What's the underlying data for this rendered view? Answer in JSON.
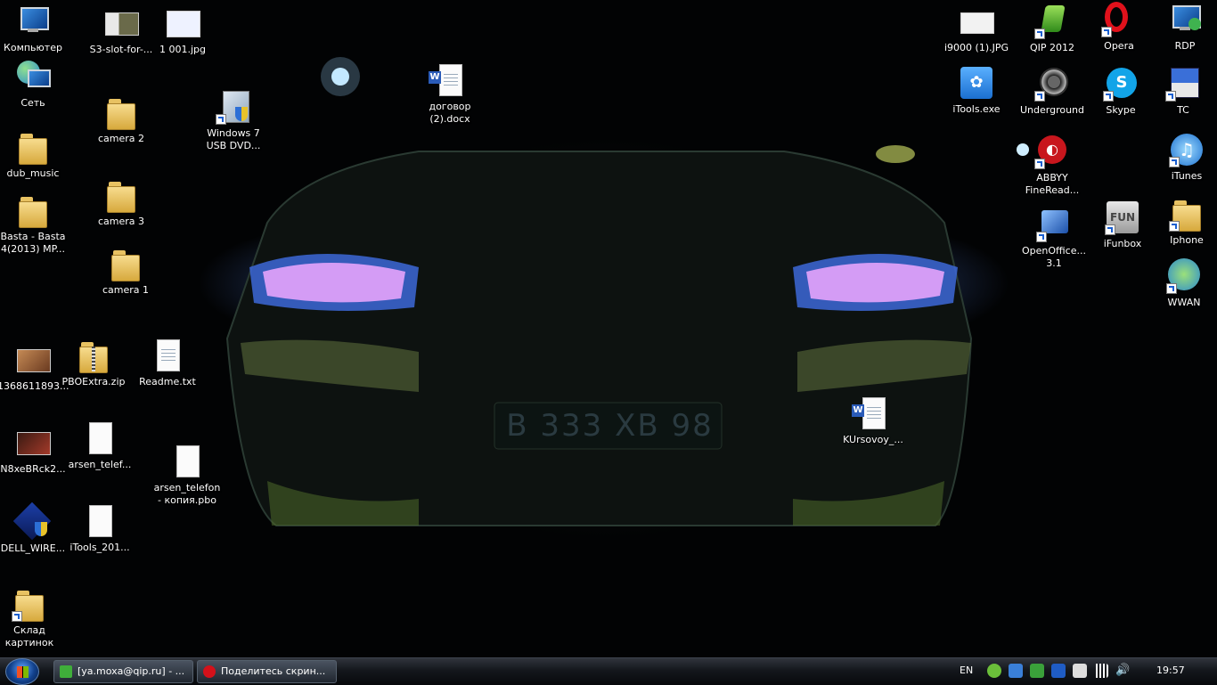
{
  "desktop": {
    "icons": [
      {
        "label": "Компьютер",
        "name": "computer-icon"
      },
      {
        "label": "Сеть",
        "name": "network-icon"
      },
      {
        "label": "dub_music",
        "name": "folder-icon"
      },
      {
        "label": "Basta - Basta\n4(2013) MP...",
        "name": "folder-icon"
      },
      {
        "label": "1368611893...",
        "name": "image-file-icon"
      },
      {
        "label": "N8xeBRck2...",
        "name": "image-file-icon"
      },
      {
        "label": "DELL_WIRE...",
        "name": "installer-icon"
      },
      {
        "label": "Склад\nкартинок",
        "name": "folder-shortcut-icon"
      },
      {
        "label": "S3-slot-for-...",
        "name": "image-file-icon"
      },
      {
        "label": "camera 2",
        "name": "folder-icon"
      },
      {
        "label": "camera 3",
        "name": "folder-icon"
      },
      {
        "label": "camera 1",
        "name": "folder-icon"
      },
      {
        "label": "PBOExtra.zip",
        "name": "zip-folder-icon"
      },
      {
        "label": "arsen_telef...",
        "name": "file-icon"
      },
      {
        "label": "iTools_201...",
        "name": "file-icon"
      },
      {
        "label": "1 001.jpg",
        "name": "image-file-icon"
      },
      {
        "label": "Windows 7\nUSB DVD...",
        "name": "installer-shortcut-icon"
      },
      {
        "label": "Readme.txt",
        "name": "text-file-icon"
      },
      {
        "label": "arsen_telefon\n- копия.pbo",
        "name": "file-icon"
      },
      {
        "label": "договор\n(2).docx",
        "name": "word-document-icon"
      },
      {
        "label": "KUrsovoy_...",
        "name": "word-document-icon"
      },
      {
        "label": "i9000 (1).JPG",
        "name": "image-file-icon"
      },
      {
        "label": "iTools.exe",
        "name": "itools-icon"
      },
      {
        "label": "QIP 2012",
        "name": "qip-icon"
      },
      {
        "label": "Underground",
        "name": "underground-icon"
      },
      {
        "label": "ABBYY\nFineRead...",
        "name": "abbyy-icon"
      },
      {
        "label": "OpenOffice...\n3.1",
        "name": "openoffice-icon"
      },
      {
        "label": "Opera",
        "name": "opera-icon"
      },
      {
        "label": "Skype",
        "name": "skype-icon"
      },
      {
        "label": "iFunbox",
        "name": "ifunbox-icon"
      },
      {
        "label": "RDP",
        "name": "rdp-icon"
      },
      {
        "label": "TC",
        "name": "total-commander-icon"
      },
      {
        "label": "iTunes",
        "name": "itunes-icon"
      },
      {
        "label": "Iphone",
        "name": "folder-shortcut-icon"
      },
      {
        "label": "WWAN",
        "name": "wwan-icon"
      }
    ]
  },
  "wallpaper": {
    "plate_text": "В 333 ХВ 98"
  },
  "taskbar": {
    "buttons": [
      {
        "label": "[ya.moxa@qip.ru] - ..."
      },
      {
        "label": "Поделитесь скрин..."
      }
    ],
    "language": "EN",
    "clock": "19:57"
  },
  "colors": {
    "taskbar_top": "#30343c",
    "taskbar_bottom": "#07090c",
    "accent": "#1a5fd0"
  }
}
